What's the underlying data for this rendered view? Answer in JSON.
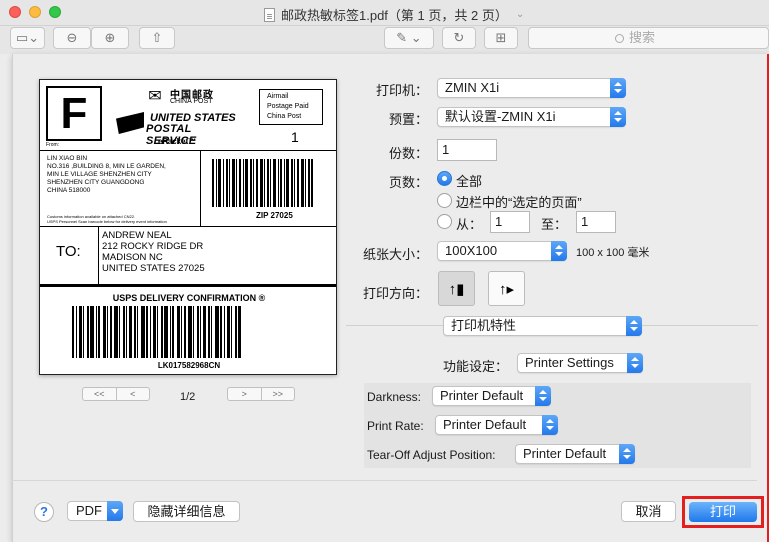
{
  "window": {
    "title": "邮政热敏标签1.pdf（第 1 页，共 2 页）"
  },
  "toolbar": {
    "search_placeholder": "搜索"
  },
  "preview": {
    "label": {
      "big_letter": "F",
      "from_label": "From:",
      "china_post_cn": "中国邮政",
      "china_post_en": "CHINA POST",
      "usps_line1": "UNITED STATES",
      "usps_line2": "POSTAL SERVICE",
      "epacket": "ePacket™",
      "airmail_lines": [
        "Airmail",
        "Postage Paid",
        "China Post"
      ],
      "box_number": "1",
      "sender_lines": [
        "LIN XIAO BIN",
        "NO.316 ,BUILDING 8, MIN LE GARDEN,",
        "MIN LE VILLAGE SHENZHEN CITY",
        "SHENZHEN CITY GUANGDONG",
        "CHINA 518000"
      ],
      "customs_note": [
        "Customs information available on attached CN22.",
        "USPS Personnel Scan barcode below for delivery event information"
      ],
      "zip": "ZIP 27025",
      "to_label": "TO:",
      "recipient_lines": [
        "ANDREW NEAL",
        "212 ROCKY RIDGE DR",
        "MADISON NC",
        "UNITED STATES 27025"
      ],
      "confirmation": "USPS DELIVERY CONFIRMATION",
      "tracking": "LK017582968CN"
    },
    "page_indicator": "1/2",
    "nav_prev": [
      "<<",
      "<"
    ],
    "nav_next": [
      ">",
      ">>"
    ]
  },
  "settings": {
    "printer_label": "打印机：",
    "printer_value": "ZMIN X1i",
    "preset_label": "预置：",
    "preset_value": "默认设置-ZMIN X1i",
    "copies_label": "份数：",
    "copies_value": "1",
    "pages_label": "页数：",
    "pages_all": "全部",
    "pages_selection": "边栏中的“选定的页面”",
    "pages_from": "从：",
    "pages_from_value": "1",
    "pages_to": "至：",
    "pages_to_value": "1",
    "paper_size_label": "纸张大小：",
    "paper_size_value": "100X100",
    "paper_size_unit": "100 x 100 毫米",
    "orientation_label": "打印方向：",
    "section_value": "打印机特性",
    "feature_label": "功能设定：",
    "feature_value": "Printer Settings",
    "darkness_label": "Darkness:",
    "darkness_value": "Printer Default",
    "print_rate_label": "Print Rate:",
    "print_rate_value": "Printer Default",
    "tearoff_label": "Tear-Off Adjust Position:",
    "tearoff_value": "Printer Default"
  },
  "footer": {
    "help": "?",
    "pdf_label": "PDF",
    "hide_details": "隐藏详细信息",
    "cancel": "取消",
    "print": "打印"
  }
}
